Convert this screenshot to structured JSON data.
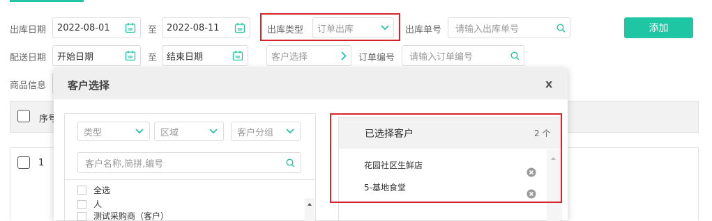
{
  "top_strip_color": "#1fc6a4",
  "filters": {
    "row1": {
      "out_date_label": "出库日期",
      "out_date_from": "2022-08-01",
      "to1": "至",
      "out_date_to": "2022-08-11",
      "out_type_label": "出库类型",
      "out_type_value": "订单出库",
      "out_no_label": "出库单号",
      "out_no_placeholder": "请输入出库单号",
      "add_button": "添加"
    },
    "row2": {
      "delivery_date_label": "配送日期",
      "delivery_from_placeholder": "开始日期",
      "to2": "至",
      "delivery_to_placeholder": "结束日期",
      "customer_select": "客户选择",
      "order_no_label": "订单编号",
      "order_no_placeholder": "请输入订单编号"
    },
    "row3": {
      "goods_info_label": "商品信息"
    }
  },
  "table": {
    "header_seq": "序号",
    "row1_seq": "1"
  },
  "modal": {
    "title": "客户选择",
    "close": "x",
    "left": {
      "type_select": "类型",
      "region_select": "区域",
      "group_select": "客户分组",
      "search_placeholder": "客户名称,简拼,编号",
      "select_all": "全选",
      "list_items": [
        "人",
        "测试采购商（客户）"
      ]
    },
    "right": {
      "selected_title": "已选择客户",
      "selected_count": "2 个",
      "selected_items": [
        "花园社区生鲜店",
        "5-基地食堂"
      ]
    }
  },
  "colors": {
    "accent": "#1fc6a4",
    "highlight": "#d4232b"
  }
}
